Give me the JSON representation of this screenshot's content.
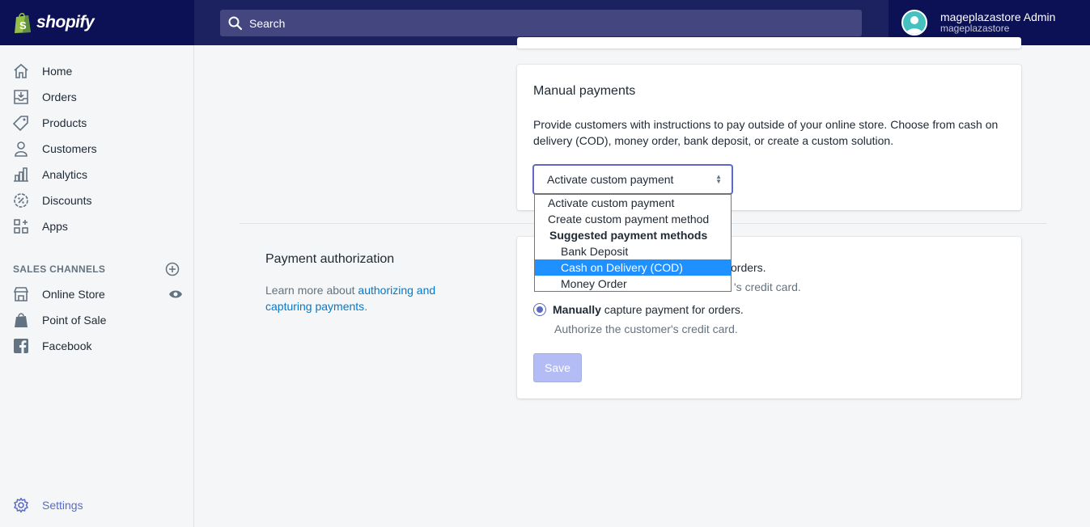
{
  "brand": {
    "name": "shopify"
  },
  "search": {
    "placeholder": "Search"
  },
  "user": {
    "name": "mageplazastore Admin",
    "store": "mageplazastore"
  },
  "sidebar": {
    "items": [
      {
        "label": "Home",
        "icon": "home-icon"
      },
      {
        "label": "Orders",
        "icon": "orders-icon"
      },
      {
        "label": "Products",
        "icon": "tag-icon"
      },
      {
        "label": "Customers",
        "icon": "person-icon"
      },
      {
        "label": "Analytics",
        "icon": "bar-chart-icon"
      },
      {
        "label": "Discounts",
        "icon": "discount-icon"
      },
      {
        "label": "Apps",
        "icon": "apps-icon"
      }
    ],
    "sales_channels": {
      "heading": "SALES CHANNELS",
      "items": [
        {
          "label": "Online Store",
          "icon": "store-icon"
        },
        {
          "label": "Point of Sale",
          "icon": "pos-bag-icon"
        },
        {
          "label": "Facebook",
          "icon": "facebook-icon"
        }
      ]
    },
    "settings": {
      "label": "Settings",
      "icon": "gear-icon"
    }
  },
  "manual_payments": {
    "title": "Manual payments",
    "description": "Provide customers with instructions to pay outside of your online store. Choose from cash on delivery (COD), money order, bank deposit, or create a custom solution.",
    "select_value": "Activate custom payment",
    "options": [
      {
        "label": "Activate custom payment",
        "kind": "option"
      },
      {
        "label": "Create custom payment method",
        "kind": "option"
      },
      {
        "label": "Suggested payment methods",
        "kind": "group"
      },
      {
        "label": "Bank Deposit",
        "kind": "sub"
      },
      {
        "label": "Cash on Delivery (COD)",
        "kind": "sub",
        "selected": true
      },
      {
        "label": "Money Order",
        "kind": "sub"
      }
    ]
  },
  "payment_authorization": {
    "title": "Payment authorization",
    "desc_prefix": "Learn more about ",
    "link_text": "authorizing and capturing payments",
    "desc_suffix": ".",
    "auto_option_tail": "orders.",
    "auto_helper_tail": "'s credit card.",
    "manual_option_bold": "Manually",
    "manual_option_rest": " capture payment for orders.",
    "manual_helper": "Authorize the customer's credit card.",
    "save_label": "Save"
  },
  "colors": {
    "accent": "#5c6ac4",
    "topbar": "#1c2260",
    "link": "#007ace",
    "highlight": "#1e90ff"
  }
}
